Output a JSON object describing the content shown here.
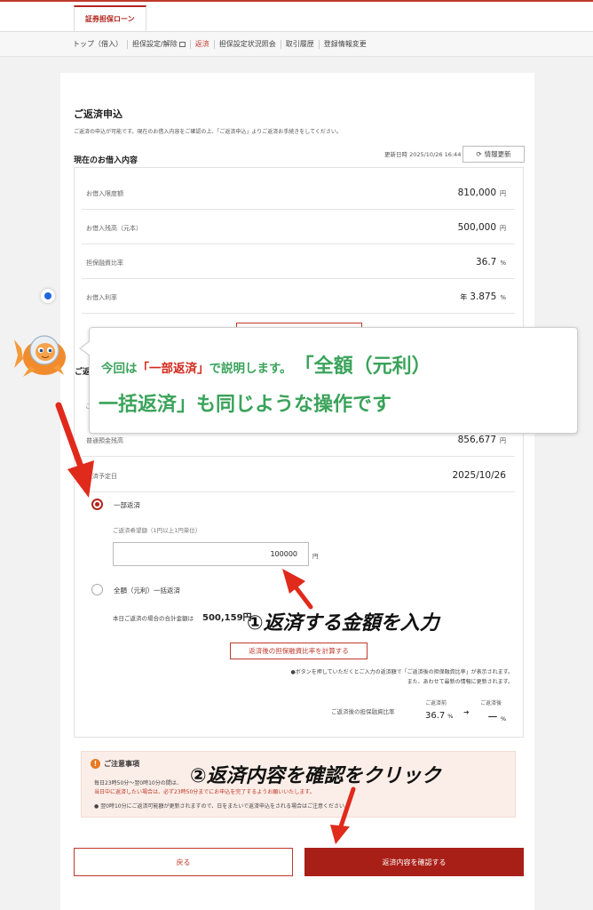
{
  "header": {
    "brand": "証券担保ローン",
    "nav": [
      "トップ（借入）",
      "担保設定/解除",
      "返済",
      "担保設定状況照会",
      "取引履歴",
      "登録情報変更"
    ],
    "active_index": 2
  },
  "page": {
    "title": "ご返済申込",
    "description": "ご返済の申込が可能です。現在のお借入内容をご確認の上、「ご返済申込」よりご返済お手続きをしてください。"
  },
  "current": {
    "heading": "現在のお借入内容",
    "updated": "更新日時 2025/10/26 16:44",
    "refresh_label": "情報更新",
    "rows": [
      {
        "label": "お借入限度額",
        "prefix": "",
        "value": "810,000",
        "unit": "円"
      },
      {
        "label": "お借入残高（元本）",
        "prefix": "",
        "value": "500,000",
        "unit": "円"
      },
      {
        "label": "担保融資比率",
        "prefix": "",
        "value": "36.7",
        "unit": "%"
      },
      {
        "label": "お借入利率",
        "prefix": "年",
        "value": "3.875",
        "unit": "%"
      }
    ]
  },
  "repay": {
    "heading_partial": "ご返",
    "cut_char": "ご",
    "rows": [
      {
        "label": "普通預金残高",
        "value": "856,677",
        "unit": "円"
      },
      {
        "label": "返済予定日",
        "value": "2025/10/26",
        "unit": ""
      }
    ],
    "option_partial": "一部返済",
    "hint": "ご返済希望額（1円以上1円単位）",
    "amount": "100000",
    "amount_unit": "円",
    "option_full": "全額（元利）一括返済",
    "total_label": "本日ご返済の場合の合計金額は",
    "total_value": "500,159円",
    "calc_button": "返済後の担保融資比率を計算する",
    "note1": "●ボタンを押していただくとご入力の返済額で「ご返済後の担保融資比率」が表示されます。",
    "note2": "また、あわせて最新の情報に更新されます。",
    "ratio_label": "ご返済後の担保融資比率",
    "before_label": "ご返済前",
    "before_value": "36.7",
    "after_label": "ご返済後",
    "after_value": "ー",
    "ratio_unit": "%"
  },
  "notice": {
    "title": "ご注意事項",
    "line1": "毎日23時50分～翌0時10分の間は、",
    "line2": "当日中に返済したい場合は、必ず23時50分までにお申込を完了するようお願いいたします。",
    "line3": "●  翌0時10分にご返済可能額が更新されますので、日をまたいで返済申込をされる場合はご注意ください。"
  },
  "buttons": {
    "back": "戻る",
    "confirm": "返済内容を確認する"
  },
  "annotations": {
    "bubble_part1": "今回は",
    "bubble_red": "「一部返済」",
    "bubble_part2": "で説明します。",
    "bubble_big1": "「全額（元利）",
    "bubble_big2": "一括返済」も同じような操作です",
    "step1": "①返済する金額を入力",
    "step2": "②返済内容を確認をクリック"
  },
  "colors": {
    "brand_red": "#b2241c",
    "bubble_green": "#3aa35a",
    "accent_blue": "#1e66e0"
  },
  "icons": [
    "refresh-icon",
    "external-link-icon",
    "warning-icon",
    "goldfish-mascot"
  ]
}
